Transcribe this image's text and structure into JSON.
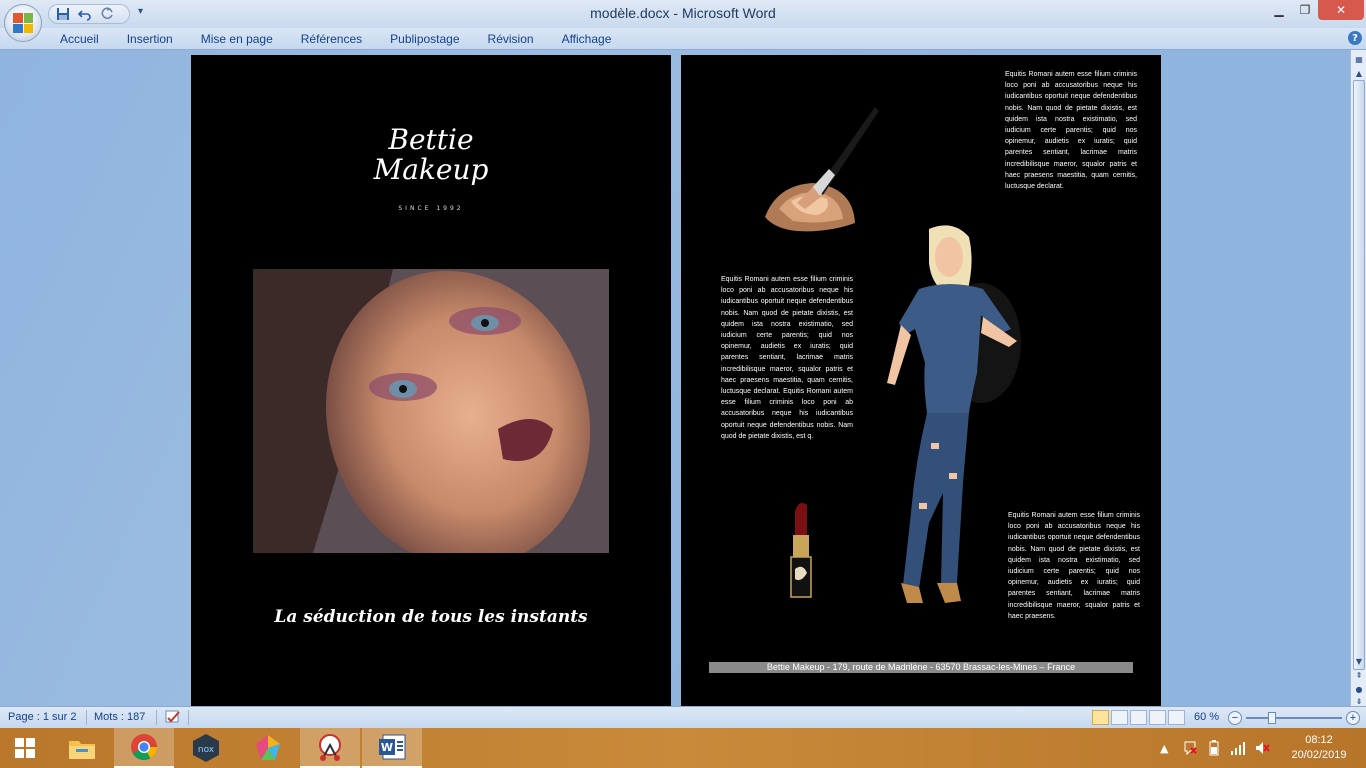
{
  "window": {
    "title": "modèle.docx - Microsoft Word",
    "minimize": "▁",
    "maximize": "❐",
    "close": "✕"
  },
  "qat": {
    "save_icon": "save-icon",
    "undo_icon": "undo-icon",
    "redo_icon": "redo-icon"
  },
  "ribbon": {
    "tabs": [
      "Accueil",
      "Insertion",
      "Mise en page",
      "Références",
      "Publipostage",
      "Révision",
      "Affichage"
    ],
    "help": "?"
  },
  "page1": {
    "brand_line1": "Bettie",
    "brand_line2": "Makeup",
    "since": "SINCE 1992",
    "slogan": "La séduction de tous les instants"
  },
  "page2": {
    "text_top": "Equitis Romani autem esse filium criminis loco poni ab accusatoribus neque his iudicantibus oportuit neque defendentibus nobis. Nam quod de pietate dixistis, est quidem ista nostra existimatio, sed iudicium certe parentis; quid nos opinemur, audietis ex iuratis; quid parentes sentiant, lacrimae matris incredibilisque maeror, squalor patris et haec praesens maestitia, quam cernitis, luctusque declarat.",
    "text_middle": "Equitis Romani autem esse filium criminis loco poni ab accusatoribus neque his iudicantibus oportuit neque defendentibus nobis. Nam quod de pietate dixistis, est quidem ista nostra existimatio, sed iudicium certe parentis; quid nos opinemur, audietis ex iuratis; quid parentes sentiant, lacrimae matris incredibilisque maeror, squalor patris et haec praesens maestitia, quam cernitis, luctusque declarat. Equitis Romani autem esse filium criminis loco poni ab accusatoribus neque his iudicantibus oportuit neque defendentibus nobis. Nam quod de pietate dixistis, est q.",
    "text_bottom": "Equitis Romani autem esse filium criminis loco poni ab accusatoribus neque his iudicantibus oportuit neque defendentibus nobis. Nam quod de pietate dixistis, est quidem ista nostra existimatio, sed iudicium certe parentis; quid nos opinemur, audietis ex iuratis; quid parentes sentiant, lacrimae matris incredibilisque maeror, squalor patris et haec praesens.",
    "footer": "Bettie Makeup - 179, route de Madrilène - 63570 Brassac-les-Mines – France"
  },
  "status": {
    "page": "Page : 1 sur 2",
    "words": "Mots : 187",
    "zoom": "60 %",
    "zoom_minus": "−",
    "zoom_plus": "+"
  },
  "taskbar": {
    "time": "08:12",
    "date": "20/02/2019",
    "apps": [
      "windows-start-icon",
      "file-explorer-icon",
      "chrome-icon",
      "nox-icon",
      "app-icon",
      "snipping-tool-icon",
      "word-icon"
    ]
  },
  "colors": {
    "ribbon_text": "#15428b",
    "page_bg": "#000000",
    "close_button": "#d7584d",
    "taskbar": "#c98a3a"
  }
}
